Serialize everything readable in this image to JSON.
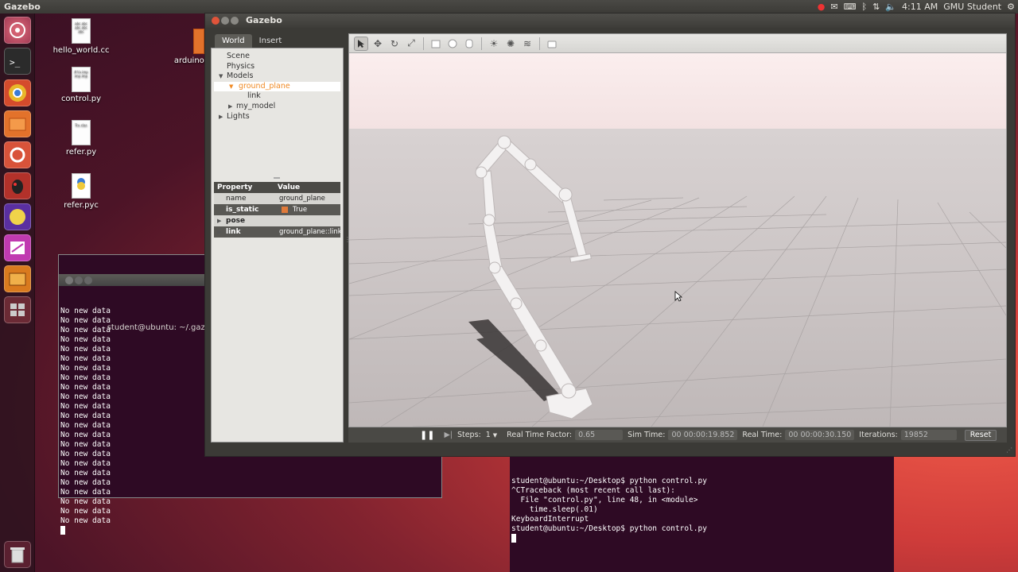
{
  "topbar": {
    "app_name": "Gazebo",
    "time": "4:11 AM",
    "user": "GMU Student"
  },
  "launcher": {
    "items": [
      "Dash Home",
      "Terminal",
      "Chromium",
      "Files",
      "Settings",
      "Bug",
      "Game",
      "Editor",
      "Software",
      "Workspaces",
      "Trash"
    ]
  },
  "desktop": {
    "icons": [
      {
        "label": "hello_world.cc"
      },
      {
        "label": "arduinoDA"
      },
      {
        "label": "control.py"
      },
      {
        "label": "refer.py"
      },
      {
        "label": "refer.pyc"
      }
    ]
  },
  "terminal1": {
    "title": "student@ubuntu: ~/.gazebo",
    "lines": [
      "No new data",
      "No new data",
      "No new data",
      "No new data",
      "No new data",
      "No new data",
      "No new data",
      "No new data",
      "No new data",
      "No new data",
      "No new data",
      "No new data",
      "No new data",
      "No new data",
      "No new data",
      "No new data",
      "No new data",
      "No new data",
      "No new data",
      "No new data",
      "No new data",
      "No new data",
      "No new data"
    ]
  },
  "terminal2": {
    "lines": [
      "student@ubuntu:~/Desktop$ python control.py",
      "^CTraceback (most recent call last):",
      "  File \"control.py\", line 48, in <module>",
      "    time.sleep(.01)",
      "KeyboardInterrupt",
      "student@ubuntu:~/Desktop$ python control.py"
    ]
  },
  "gazebo": {
    "title": "Gazebo",
    "tabs": [
      "World",
      "Insert"
    ],
    "tree": {
      "scene": "Scene",
      "physics": "Physics",
      "models": "Models",
      "ground_plane": "ground_plane",
      "link": "link",
      "my_model": "my_model",
      "lights": "Lights"
    },
    "properties": {
      "header": {
        "property": "Property",
        "value": "Value"
      },
      "rows": [
        {
          "key": "name",
          "value": "ground_plane"
        },
        {
          "key": "is_static",
          "value": "True"
        },
        {
          "key": "pose",
          "value": ""
        },
        {
          "key": "link",
          "value": "ground_plane::link"
        }
      ]
    },
    "toolbar": [
      "select-icon",
      "translate-icon",
      "rotate-icon",
      "scale-icon",
      "box-icon",
      "sphere-icon",
      "cylinder-icon",
      "point-light-icon",
      "spot-light-icon",
      "directional-light-icon",
      "screenshot-icon"
    ],
    "bottom": {
      "steps_label": "Steps:",
      "steps_value": "1",
      "rtf_label": "Real Time Factor:",
      "rtf_value": "0.65",
      "sim_label": "Sim Time:",
      "sim_value": "00 00:00:19.852",
      "real_label": "Real Time:",
      "real_value": "00 00:00:30.150",
      "iter_label": "Iterations:",
      "iter_value": "19852",
      "reset": "Reset"
    },
    "colors": {
      "selection": "#f08a24",
      "sky": "#f7e9e9",
      "ground": "#cbc4c4"
    }
  }
}
